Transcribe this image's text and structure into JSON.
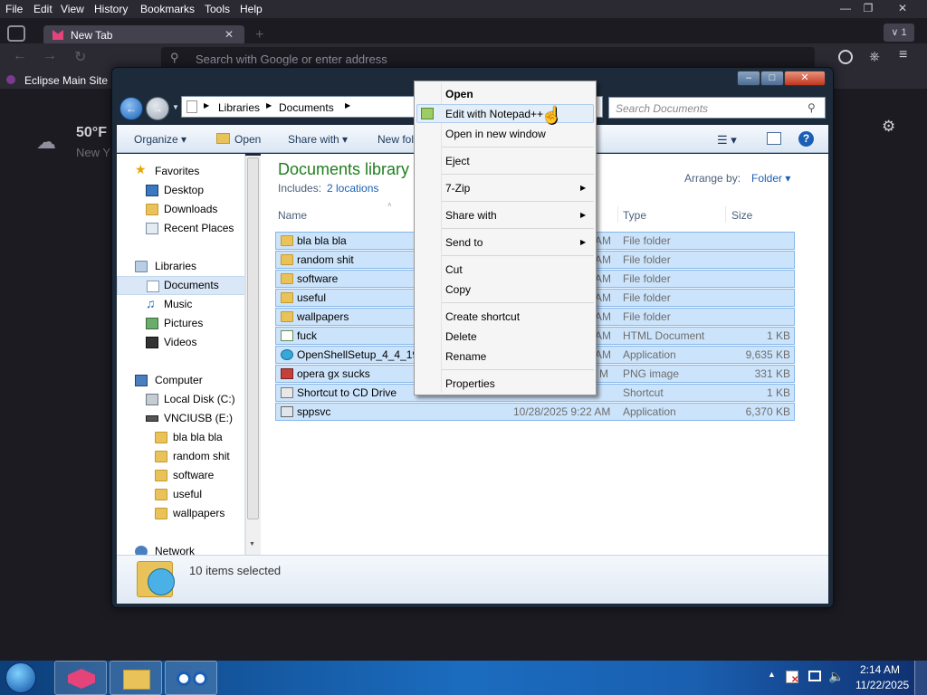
{
  "browser": {
    "menus": [
      "File",
      "Edit",
      "View",
      "History",
      "Bookmarks",
      "Tools",
      "Help"
    ],
    "menu_shortcuts": [
      "F",
      "E",
      "V",
      "s",
      "B",
      "T",
      "H"
    ],
    "tab_title": "New Tab",
    "url_placeholder": "Search with Google or enter address",
    "bookmark": "Eclipse Main Site",
    "weather_temp": "50°F",
    "weather_loc": "New Y",
    "tab_count": "1"
  },
  "explorer": {
    "breadcrumb": [
      "Libraries",
      "Documents"
    ],
    "search_placeholder": "Search Documents",
    "commands": {
      "organize": "Organize",
      "open": "Open",
      "share": "Share with",
      "newfolder": "New fol"
    },
    "library_title": "Documents library",
    "includes_label": "Includes:",
    "includes_link": "2 locations",
    "arrange_label": "Arrange by:",
    "arrange_value": "Folder",
    "columns": {
      "name": "Name",
      "type": "Type",
      "size": "Size"
    },
    "nav": {
      "favorites": "Favorites",
      "fav_items": [
        "Desktop",
        "Downloads",
        "Recent Places"
      ],
      "libraries": "Libraries",
      "lib_items": [
        "Documents",
        "Music",
        "Pictures",
        "Videos"
      ],
      "computer": "Computer",
      "drives": [
        "Local Disk (C:)",
        "VNCIUSB (E:)"
      ],
      "usb_items": [
        "bla bla bla",
        "random shit",
        "software",
        "useful",
        "wallpapers"
      ],
      "network": "Network"
    },
    "files": [
      {
        "name": "bla bla bla",
        "date": "AM",
        "type": "File folder",
        "size": ""
      },
      {
        "name": "random shit",
        "date": "AM",
        "type": "File folder",
        "size": ""
      },
      {
        "name": "software",
        "date": "AM",
        "type": "File folder",
        "size": ""
      },
      {
        "name": "useful",
        "date": "AM",
        "type": "File folder",
        "size": ""
      },
      {
        "name": "wallpapers",
        "date": "AM",
        "type": "File folder",
        "size": ""
      },
      {
        "name": "fuck",
        "date": "AM",
        "type": "HTML Document",
        "size": "1 KB"
      },
      {
        "name": "OpenShellSetup_4_4_196",
        "date": "AM",
        "type": "Application",
        "size": "9,635 KB"
      },
      {
        "name": "opera gx sucks",
        "date": "M",
        "type": "PNG image",
        "size": "331 KB"
      },
      {
        "name": "Shortcut to CD Drive",
        "date": "",
        "type": "Shortcut",
        "size": "1 KB"
      },
      {
        "name": "sppsvc",
        "date": "10/28/2025 9:22 AM",
        "type": "Application",
        "size": "6,370 KB"
      }
    ],
    "status": "10 items selected"
  },
  "context_menu": {
    "open": "Open",
    "edit_notepad": "Edit with Notepad++",
    "open_new_window": "Open in new window",
    "eject": "Eject",
    "zip": "7-Zip",
    "share_with": "Share with",
    "send_to": "Send to",
    "cut": "Cut",
    "copy": "Copy",
    "create_shortcut": "Create shortcut",
    "delete": "Delete",
    "rename": "Rename",
    "properties": "Properties"
  },
  "taskbar": {
    "time": "2:14 AM",
    "date": "11/22/2025"
  },
  "colors": {
    "browser_bg": "#1c1b22",
    "library_title": "#1e7f1e",
    "link": "#1a5fb4",
    "selection": "#cce4fb"
  }
}
